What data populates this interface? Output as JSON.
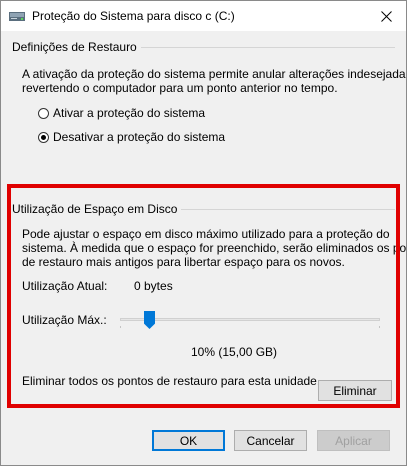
{
  "window": {
    "title": "Proteção do Sistema para disco c (C:)"
  },
  "restore_settings": {
    "group_label": "Definições de Restauro",
    "description_line1": "A ativação da proteção do sistema permite anular alterações indesejadas",
    "description_line2": "revertendo o computador para um ponto anterior no tempo.",
    "option_enable": "Ativar a proteção do sistema",
    "option_disable": "Desativar a proteção do sistema",
    "selected": "disable"
  },
  "disk_usage": {
    "group_label": "Utilização de Espaço em Disco",
    "description_line1": "Pode ajustar o espaço em disco máximo utilizado para a proteção do",
    "description_line2": "sistema. À medida que o espaço for preenchido, serão eliminados os pontos",
    "description_line3": "de restauro mais antigos para libertar espaço para os novos.",
    "current_label": "Utilização Atual:",
    "current_value": "0 bytes",
    "max_label": "Utilização Máx.:",
    "max_percent": 10,
    "max_value_text": "10% (15,00 GB)",
    "delete_text": "Eliminar todos os pontos de restauro para esta unidade.",
    "delete_button": "Eliminar"
  },
  "buttons": {
    "ok": "OK",
    "cancel": "Cancelar",
    "apply": "Aplicar"
  },
  "colors": {
    "accent": "#0078d7",
    "highlight": "#e00000"
  }
}
